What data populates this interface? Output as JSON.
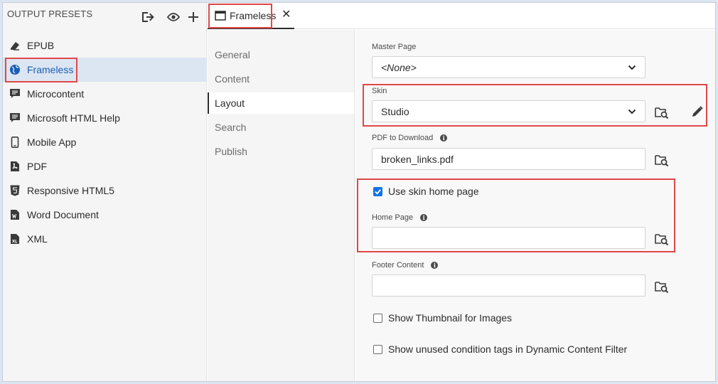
{
  "sidebar": {
    "title": "OUTPUT PRESETS",
    "header_icons": [
      "export-icon",
      "eye-icon",
      "plus-icon"
    ],
    "items": [
      {
        "label": "EPUB",
        "icon": "epub-icon"
      },
      {
        "label": "Frameless",
        "icon": "globe-icon",
        "active": true
      },
      {
        "label": "Microcontent",
        "icon": "microcontent-icon"
      },
      {
        "label": "Microsoft HTML Help",
        "icon": "help-icon"
      },
      {
        "label": "Mobile App",
        "icon": "mobile-icon"
      },
      {
        "label": "PDF",
        "icon": "pdf-icon"
      },
      {
        "label": "Responsive HTML5",
        "icon": "html5-icon"
      },
      {
        "label": "Word Document",
        "icon": "word-icon"
      },
      {
        "label": "XML",
        "icon": "xml-icon"
      }
    ]
  },
  "tab": {
    "label": "Frameless",
    "close": "✕"
  },
  "nav": {
    "items": [
      "General",
      "Content",
      "Layout",
      "Search",
      "Publish"
    ],
    "active": "Layout"
  },
  "form": {
    "master_page": {
      "label": "Master Page",
      "value": "<None>"
    },
    "skin": {
      "label": "Skin",
      "value": "Studio"
    },
    "pdf_download": {
      "label": "PDF to Download",
      "value": "broken_links.pdf"
    },
    "use_skin_home": {
      "label": "Use skin home page",
      "checked": true
    },
    "home_page": {
      "label": "Home Page",
      "value": ""
    },
    "footer_content": {
      "label": "Footer Content",
      "value": ""
    },
    "show_thumbnail": {
      "label": "Show Thumbnail for Images",
      "checked": false
    },
    "show_unused": {
      "label": "Show unused condition tags in Dynamic Content Filter",
      "checked": false
    }
  },
  "colors": {
    "accent": "#1473e6",
    "highlight": "#e04848",
    "active_item": "#dce5f2"
  }
}
